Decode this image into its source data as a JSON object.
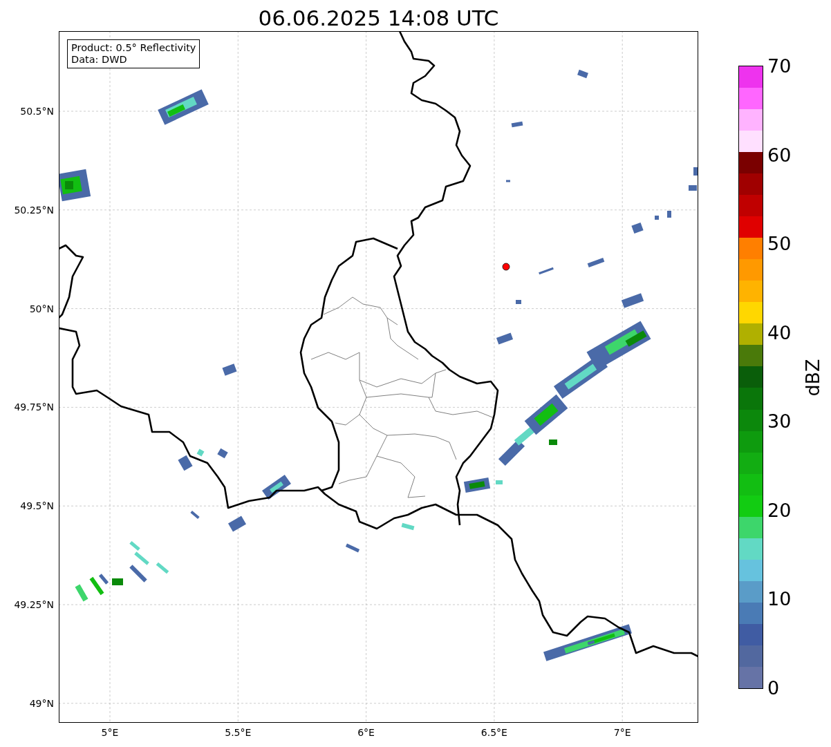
{
  "title": "06.06.2025 14:08 UTC",
  "info_box": {
    "lines": [
      "Product: 0.5° Reflectivity",
      "Data: DWD"
    ]
  },
  "map": {
    "lat_ticks": [
      "50.5°N",
      "50.25°N",
      "50°N",
      "49.75°N",
      "49.5°N",
      "49.25°N",
      "49°N"
    ],
    "lon_ticks": [
      "5°E",
      "5.5°E",
      "6°E",
      "6.5°E",
      "7°E"
    ],
    "marker": {
      "color": "#ff0000"
    }
  },
  "colorbar": {
    "label": "dBZ",
    "ticks": [
      "70",
      "60",
      "50",
      "40",
      "30",
      "20",
      "10",
      "0"
    ],
    "bins": [
      {
        "color": "#ee33ee"
      },
      {
        "color": "#ff66ff"
      },
      {
        "color": "#ffb3ff"
      },
      {
        "color": "#ffe0ff"
      },
      {
        "color": "#7a0000"
      },
      {
        "color": "#a00000"
      },
      {
        "color": "#c00000"
      },
      {
        "color": "#e00000"
      },
      {
        "color": "#ff7f00"
      },
      {
        "color": "#ff9900"
      },
      {
        "color": "#ffb300"
      },
      {
        "color": "#ffd700"
      },
      {
        "color": "#b0b000"
      },
      {
        "color": "#4a7a0a"
      },
      {
        "color": "#0a5e0a"
      },
      {
        "color": "#0a760a"
      },
      {
        "color": "#0c880c"
      },
      {
        "color": "#0e9b0e"
      },
      {
        "color": "#12ad12"
      },
      {
        "color": "#12be12"
      },
      {
        "color": "#12cc12"
      },
      {
        "color": "#3dd66b"
      },
      {
        "color": "#62d9c4"
      },
      {
        "color": "#66c2de"
      },
      {
        "color": "#5a9cc8"
      },
      {
        "color": "#4a7bb5"
      },
      {
        "color": "#405ca3"
      },
      {
        "color": "#52689f"
      },
      {
        "color": "#6673a6"
      }
    ]
  }
}
